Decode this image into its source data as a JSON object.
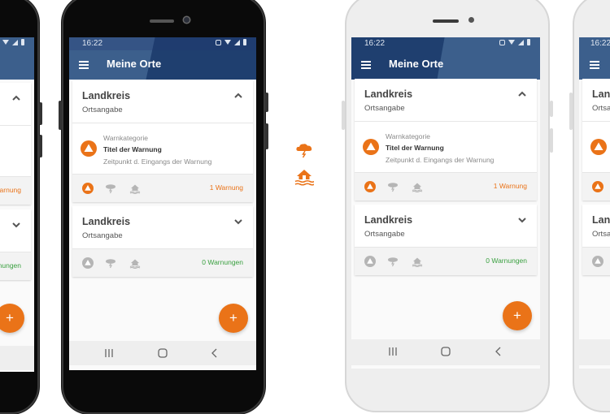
{
  "colors": {
    "brand_dark": "#1f3f6f",
    "brand_light": "#3c5f8c",
    "accent_orange": "#ea7318",
    "status_green": "#3aa040",
    "icon_gray": "#b5b5b5"
  },
  "status_bar": {
    "time": "16:22",
    "icons": [
      "alarm-icon",
      "wifi-icon",
      "signal-icon",
      "battery-icon"
    ]
  },
  "app_bar": {
    "menu_icon": "hamburger-menu-icon",
    "title": "Meine Orte"
  },
  "places": [
    {
      "district": "Landkreis",
      "location": "Ortsangabe",
      "expanded": true,
      "chevron_icon": "chevron-up-icon",
      "warnings": [
        {
          "category": "Warnkategorie",
          "title": "Titel der Warnung",
          "received": "Zeitpunkt d. Eingangs der Warnung",
          "icon": "civil-protection-warning-icon"
        }
      ],
      "category_icons": [
        "civil-protection-icon",
        "storm-icon",
        "flood-icon"
      ],
      "active_category": 0,
      "count_label": "1 Warnung",
      "count_color": "#ea7318"
    },
    {
      "district": "Landkreis",
      "location": "Ortsangabe",
      "expanded": false,
      "chevron_icon": "chevron-down-icon",
      "warnings": [],
      "category_icons": [
        "civil-protection-icon",
        "storm-icon",
        "flood-icon"
      ],
      "active_category": -1,
      "count_label": "0 Warnungen",
      "count_color": "#3aa040"
    }
  ],
  "fab": {
    "label": "+",
    "icon": "add-icon"
  },
  "nav_bar": {
    "buttons": [
      "recent-apps-icon",
      "home-icon",
      "back-icon"
    ]
  },
  "floating_icons": [
    "storm-icon",
    "flood-icon"
  ]
}
